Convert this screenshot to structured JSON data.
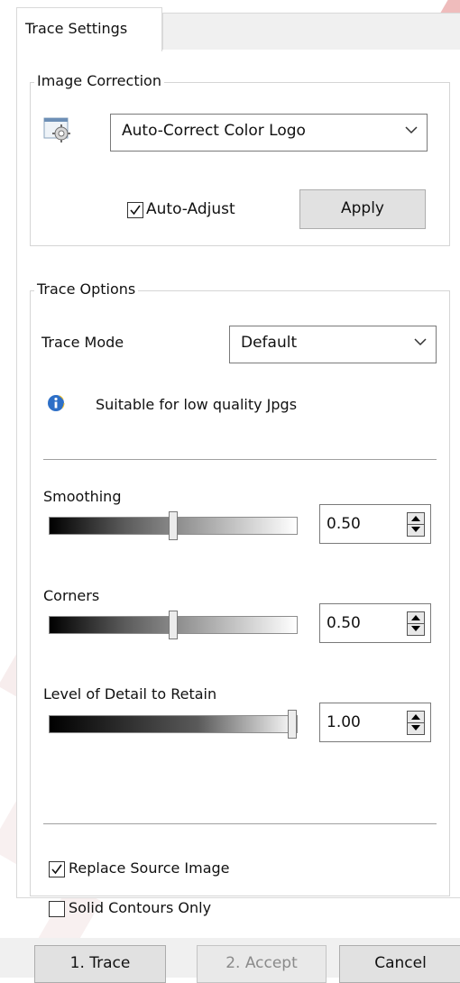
{
  "tab": {
    "label": "Trace Settings"
  },
  "image_correction": {
    "title": "Image Correction",
    "preset_selected": "Auto-Correct Color Logo",
    "auto_adjust_label": "Auto-Adjust",
    "auto_adjust_checked": true,
    "apply_label": "Apply"
  },
  "trace_options": {
    "title": "Trace Options",
    "trace_mode_label": "Trace Mode",
    "trace_mode_selected": "Default",
    "info_text": "Suitable for low quality Jpgs",
    "smoothing": {
      "label": "Smoothing",
      "value": "0.50",
      "fraction": 0.5
    },
    "corners": {
      "label": "Corners",
      "value": "0.50",
      "fraction": 0.5
    },
    "detail": {
      "label": "Level of Detail to Retain",
      "value": "1.00",
      "fraction": 1.0
    },
    "replace_source_label": "Replace Source Image",
    "replace_source_checked": true,
    "solid_contours_label": "Solid Contours Only",
    "solid_contours_checked": false
  },
  "footer": {
    "trace_label": "1. Trace",
    "accept_label": "2. Accept",
    "cancel_label": "Cancel"
  },
  "icons": {
    "settings": "settings-gear-icon",
    "info": "info-icon",
    "dropdown": "chevron-down-icon"
  }
}
